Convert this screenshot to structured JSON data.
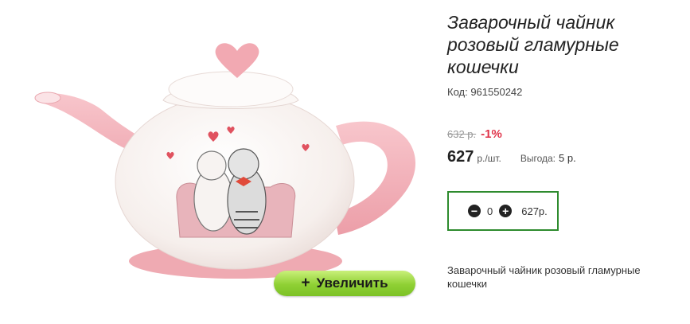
{
  "product": {
    "title": "Заварочный чайник розовый гламурные кошечки",
    "code": "Код: 961550242",
    "old_price": "632 р.",
    "discount": "-1%",
    "price": "627",
    "price_unit": "р./шт.",
    "benefit_label": "Выгода:",
    "benefit_value": "5 р.",
    "description": "Заварочный чайник розовый гламурные кошечки"
  },
  "quantity": {
    "minus_icon": "minus-circle-icon",
    "value": "0",
    "plus_icon": "plus-circle-icon",
    "total": "627р."
  },
  "zoom": {
    "plus": "+",
    "label": "Увеличить"
  },
  "colors": {
    "discount": "#e0344a",
    "button_green": "#8fd034",
    "qty_border": "#2e8b2e",
    "teapot_pink": "#f4b6bd"
  }
}
